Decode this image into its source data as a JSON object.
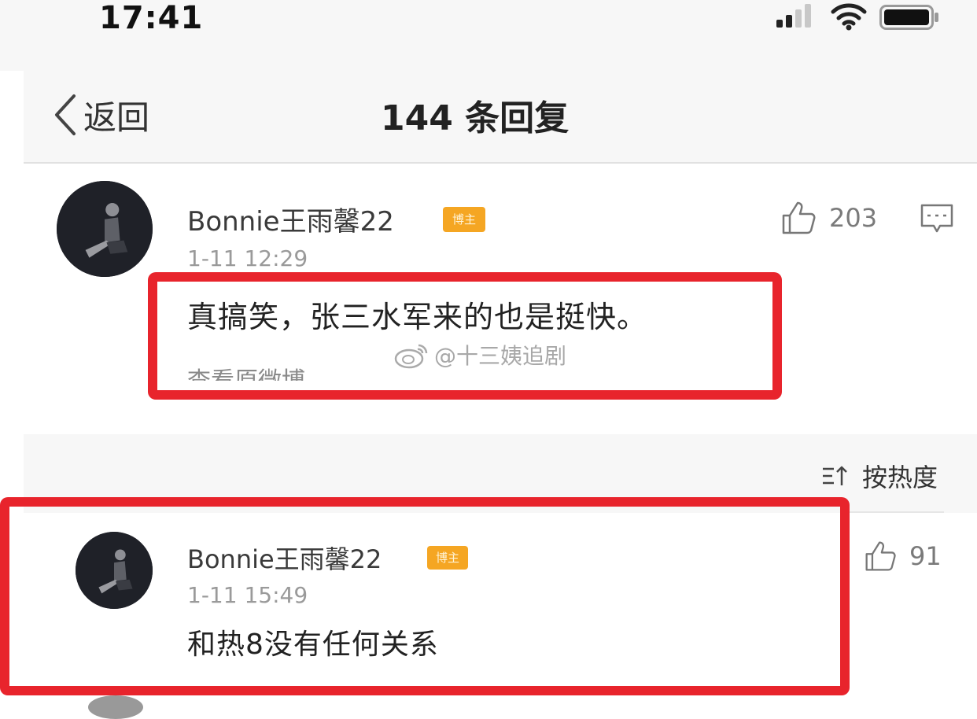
{
  "status_bar": {
    "time": "17:41"
  },
  "nav": {
    "back_label": "返回",
    "title": "144 条回复"
  },
  "main_comment": {
    "username": "Bonnie王雨馨22",
    "badge": "博主",
    "timestamp": "1-11 12:29",
    "likes": "203",
    "text": "真搞笑，张三水军来的也是挺快。",
    "view_original": "查看原微博"
  },
  "watermark": "@十三姨追剧",
  "sort": {
    "label": "按热度"
  },
  "reply": {
    "username": "Bonnie王雨馨22",
    "badge": "博主",
    "timestamp": "1-11 15:49",
    "likes": "91",
    "text": "和热8没有任何关系"
  },
  "colors": {
    "highlight": "#e8242c",
    "badge": "#f5a623"
  }
}
